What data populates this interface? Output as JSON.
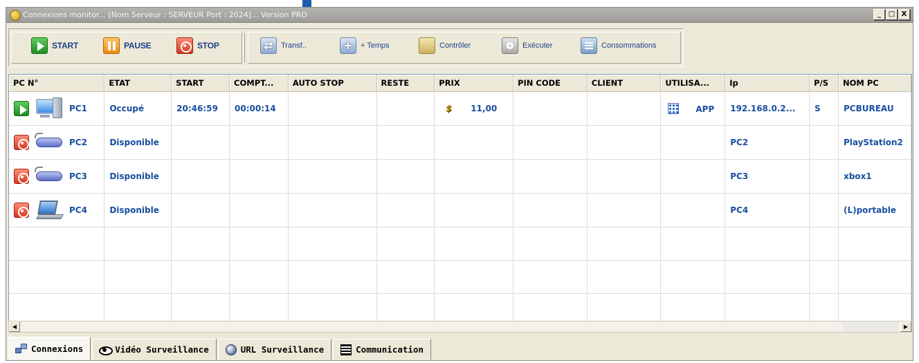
{
  "window": {
    "title": "Connexions monitor... [Nom Serveur : SERVEUR  Port : 2024]... Version PRO",
    "min_label": "_",
    "max_label": "□",
    "close_label": "X"
  },
  "toolbar": {
    "start": "START",
    "pause": "PAUSE",
    "stop": "STOP",
    "transf": "Transf..",
    "temps": "+ Temps",
    "controler": "Contrôler",
    "executer": "Exécuter",
    "consommations": "Consommations"
  },
  "table": {
    "columns": [
      "PC N°",
      "ETAT",
      "START",
      "COMPT...",
      "AUTO STOP",
      "RESTE",
      "PRIX",
      "PIN CODE",
      "CLIENT",
      "UTILISA...",
      "Ip",
      "P/S",
      "NOM PC"
    ],
    "rows": [
      {
        "status_icon": "play-icon",
        "device_icon": "desktop-computer-icon",
        "pc": "PC1",
        "etat": "Occupé",
        "start": "20:46:59",
        "compteur": "00:00:14",
        "auto_stop": "",
        "reste": "",
        "prix_icon": "dollar-icon",
        "prix": "11,00",
        "pin_code": "",
        "client": "",
        "utilisateur_icon": "app-grid-icon",
        "utilisateur": "APP",
        "ip": "192.168.0.2...",
        "ps": "S",
        "nom_pc": "PCBUREAU"
      },
      {
        "status_icon": "stop-icon",
        "device_icon": "gamepad-icon",
        "pc": "PC2",
        "etat": "Disponible",
        "start": "",
        "compteur": "",
        "auto_stop": "",
        "reste": "",
        "prix_icon": "",
        "prix": "",
        "pin_code": "",
        "client": "",
        "utilisateur_icon": "",
        "utilisateur": "",
        "ip": "PC2",
        "ps": "",
        "nom_pc": "PlayStation2"
      },
      {
        "status_icon": "stop-icon",
        "device_icon": "gamepad-icon",
        "pc": "PC3",
        "etat": "Disponible",
        "start": "",
        "compteur": "",
        "auto_stop": "",
        "reste": "",
        "prix_icon": "",
        "prix": "",
        "pin_code": "",
        "client": "",
        "utilisateur_icon": "",
        "utilisateur": "",
        "ip": "PC3",
        "ps": "",
        "nom_pc": "xbox1"
      },
      {
        "status_icon": "stop-icon",
        "device_icon": "laptop-icon",
        "pc": "PC4",
        "etat": "Disponible",
        "start": "",
        "compteur": "",
        "auto_stop": "",
        "reste": "",
        "prix_icon": "",
        "prix": "",
        "pin_code": "",
        "client": "",
        "utilisateur_icon": "",
        "utilisateur": "",
        "ip": "PC4",
        "ps": "",
        "nom_pc": "(L)portable"
      }
    ],
    "empty_rows": 3
  },
  "tabs": [
    {
      "icon": "network-icon",
      "label": "Connexions",
      "active": true
    },
    {
      "icon": "eye-icon",
      "label": "Vidéo Surveillance",
      "active": false
    },
    {
      "icon": "globe-icon",
      "label": "URL Surveillance",
      "active": false
    },
    {
      "icon": "chat-icon",
      "label": "Communication",
      "active": false
    }
  ],
  "colors": {
    "cell_text": "#1a4fa0",
    "start_green": "#1e8c1e",
    "pause_orange": "#f08a10",
    "stop_red": "#d6361e",
    "window_bg": "#ece9d8"
  }
}
